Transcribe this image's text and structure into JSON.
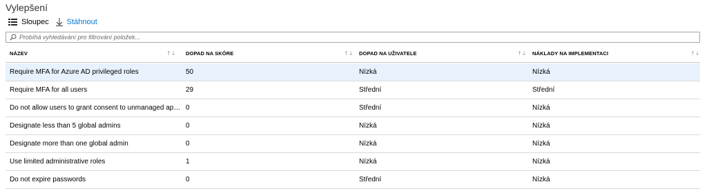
{
  "page": {
    "title": "Vylepšení"
  },
  "toolbar": {
    "columns_label": "Sloupec",
    "download_label": "Stáhnout"
  },
  "search": {
    "placeholder": "Probíhá vyhledávání pro filtrování položek..."
  },
  "colors": {
    "accent": "#0078d4",
    "selected_row": "#e8f2fd",
    "border": "#c8c8c8"
  },
  "table": {
    "columns": [
      {
        "label": "NÁZEV"
      },
      {
        "label": "DOPAD NA SKÓRE"
      },
      {
        "label": "DOPAD NA UŽIVATELE"
      },
      {
        "label": "NÁKLADY NA IMPLEMENTACI"
      }
    ],
    "rows": [
      {
        "name": "Require MFA for Azure AD privileged roles",
        "score": "50",
        "user_impact": "Nízká",
        "cost": "Nízká",
        "selected": true
      },
      {
        "name": "Require MFA for all users",
        "score": "29",
        "user_impact": "Střední",
        "cost": "Střední",
        "selected": false
      },
      {
        "name": "Do not allow users to grant consent to unmanaged app...",
        "score": "0",
        "user_impact": "Střední",
        "cost": "Nízká",
        "selected": false
      },
      {
        "name": "Designate less than 5 global admins",
        "score": "0",
        "user_impact": "Nízká",
        "cost": "Nízká",
        "selected": false
      },
      {
        "name": "Designate more than one global admin",
        "score": "0",
        "user_impact": "Nízká",
        "cost": "Nízká",
        "selected": false
      },
      {
        "name": "Use limited administrative roles",
        "score": "1",
        "user_impact": "Nízká",
        "cost": "Nízká",
        "selected": false
      },
      {
        "name": "Do not expire passwords",
        "score": "0",
        "user_impact": "Střední",
        "cost": "Nízká",
        "selected": false
      }
    ]
  }
}
